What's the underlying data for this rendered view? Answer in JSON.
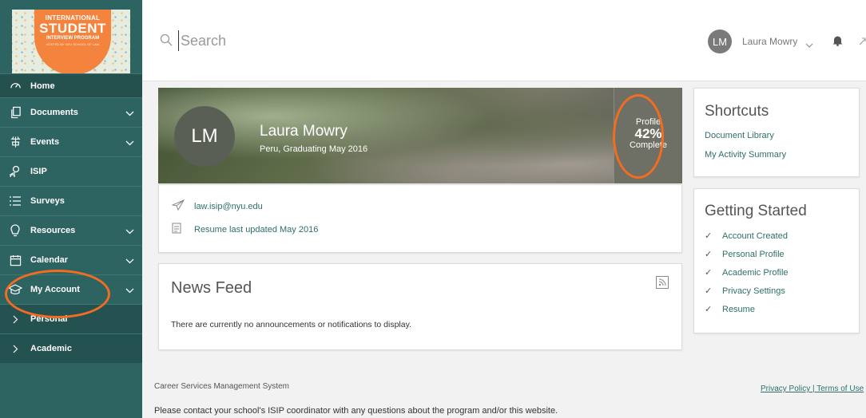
{
  "logo": {
    "line1": "INTERNATIONAL",
    "line2": "STUDENT",
    "line3": "INTERVIEW PROGRAM",
    "line4": "HOSTED BY NYU SCHOOL OF LAW"
  },
  "sidebar": {
    "items": [
      {
        "label": "Home",
        "icon": "dashboard-icon"
      },
      {
        "label": "Documents",
        "icon": "documents-icon"
      },
      {
        "label": "Events",
        "icon": "events-icon"
      },
      {
        "label": "ISIP",
        "icon": "isip-icon"
      },
      {
        "label": "Surveys",
        "icon": "list-icon"
      },
      {
        "label": "Resources",
        "icon": "lightbulb-icon"
      },
      {
        "label": "Calendar",
        "icon": "calendar-icon"
      },
      {
        "label": "My Account",
        "icon": "graduation-cap-icon"
      },
      {
        "label": "Personal",
        "icon": "chevron-right-icon"
      },
      {
        "label": "Academic",
        "icon": "chevron-right-icon"
      }
    ]
  },
  "header": {
    "search_placeholder": "Search",
    "user_initials": "LM",
    "user_name": "Laura Mowry"
  },
  "profile": {
    "initials": "LM",
    "name": "Laura Mowry",
    "subtitle": "Peru, Graduating May 2016",
    "complete_label_top": "Profile",
    "complete_percent": "42%",
    "complete_label_bottom": "Complete",
    "email": "law.isip@nyu.edu",
    "resume": "Resume last updated May 2016"
  },
  "news": {
    "title": "News Feed",
    "empty": "There are currently no announcements or notifications to display."
  },
  "shortcuts": {
    "title": "Shortcuts",
    "links": [
      "Document Library",
      "My Activity Summary"
    ]
  },
  "getting_started": {
    "title": "Getting Started",
    "items": [
      "Account Created",
      "Personal Profile",
      "Academic Profile",
      "Privacy Settings",
      "Resume"
    ]
  },
  "footer": {
    "system": "Career Services Management System",
    "privacy": "Privacy Policy",
    "separator": "|",
    "terms": "Terms of Use",
    "contact": "Please contact your school's ISIP coordinator with any questions about the program and/or this website."
  },
  "colors": {
    "sidebar_bg": "#2d6361",
    "link": "#2f6f6a",
    "highlight": "#f26d21"
  }
}
